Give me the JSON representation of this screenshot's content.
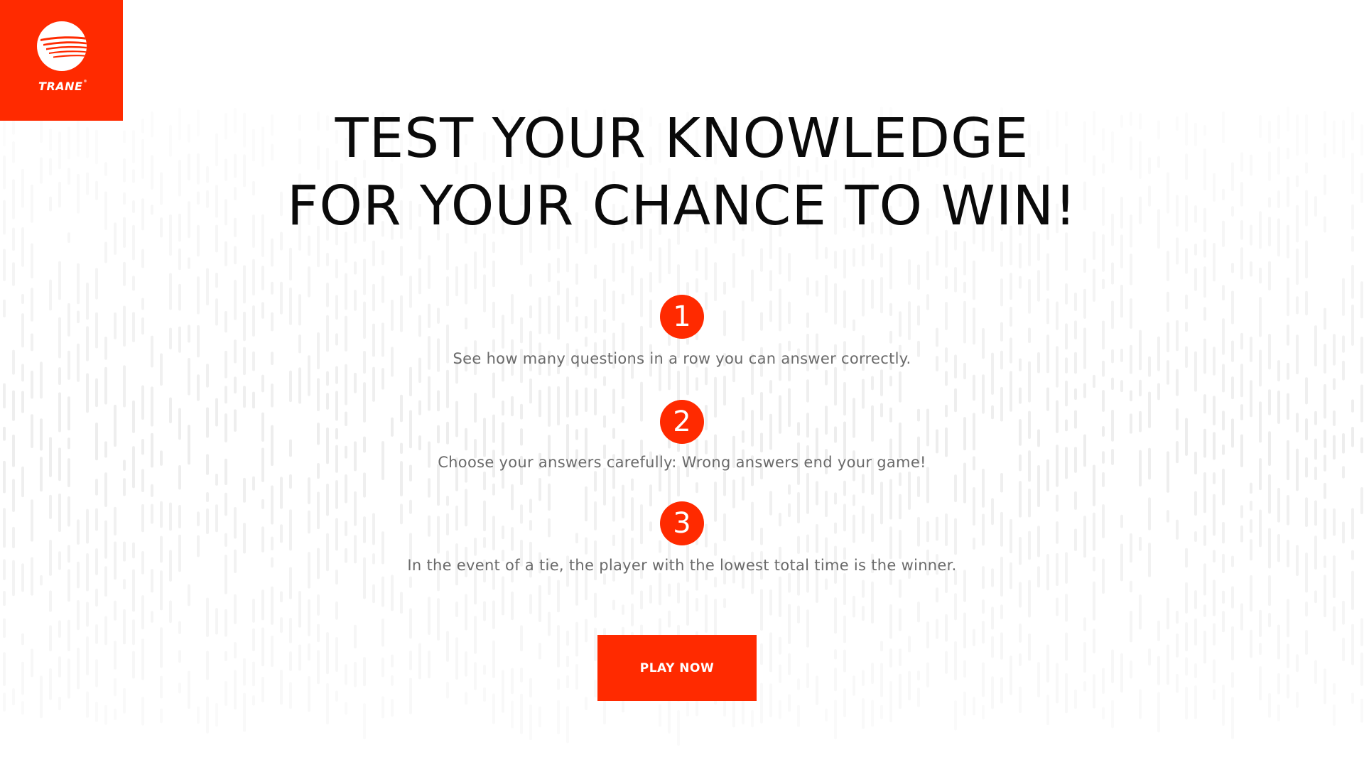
{
  "brand": {
    "logo_text": "TRANE",
    "logo_icon": "trane-globe-icon",
    "color": "#ff2a00"
  },
  "headline": {
    "line1": "TEST YOUR KNOWLEDGE",
    "line2": "FOR YOUR CHANCE TO WIN!"
  },
  "steps": [
    {
      "number": "1",
      "text": "See how many questions in a row you can answer correctly."
    },
    {
      "number": "2",
      "text": "Choose your answers carefully: Wrong answers end your game!"
    },
    {
      "number": "3",
      "text": "In the event of a tie, the player with the lowest total time is the winner."
    }
  ],
  "cta": {
    "play_label": "PLAY NOW"
  }
}
